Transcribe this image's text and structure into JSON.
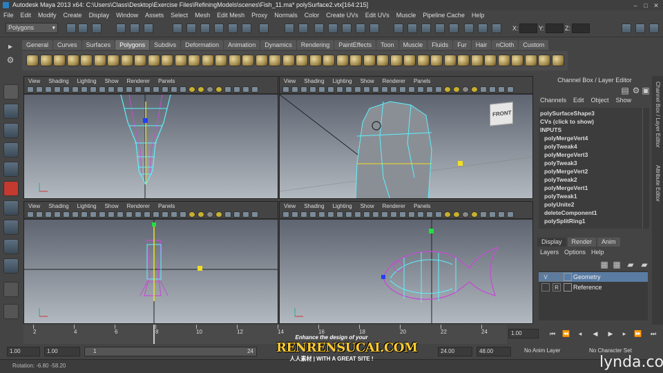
{
  "title": "Autodesk Maya 2013 x64: C:\\Users\\Class\\Desktop\\Exercise Files\\RefiningModels\\scenes\\Fish_11.ma*     polySurface2.vtx[164:215]",
  "window_controls": [
    "–",
    "□",
    "✕"
  ],
  "menubar": [
    "File",
    "Edit",
    "Modify",
    "Create",
    "Display",
    "Window",
    "Assets",
    "Select",
    "Mesh",
    "Edit Mesh",
    "Proxy",
    "Normals",
    "Color",
    "Create UVs",
    "Edit UVs",
    "Muscle",
    "Pipeline Cache",
    "Help"
  ],
  "status": {
    "mode": "Polygons",
    "x_label": "X:",
    "y_label": "Y:",
    "z_label": "Z:"
  },
  "shelf_tabs": [
    "General",
    "Curves",
    "Surfaces",
    "Polygons",
    "Subdivs",
    "Deformation",
    "Animation",
    "Dynamics",
    "Rendering",
    "PaintEffects",
    "Toon",
    "Muscle",
    "Fluids",
    "Fur",
    "Hair",
    "nCloth",
    "Custom"
  ],
  "shelf_active": "Polygons",
  "viewport_menu": [
    "View",
    "Shading",
    "Lighting",
    "Show",
    "Renderer",
    "Panels"
  ],
  "viewcube_label": "FRONT",
  "channel_box": {
    "title": "Channel Box / Layer Editor",
    "menu": [
      "Channels",
      "Edit",
      "Object",
      "Show"
    ],
    "shape": "polySurfaceShape3",
    "cvs": "CVs (click to show)",
    "inputs_header": "INPUTS",
    "inputs": [
      "polyMergeVert4",
      "polyTweak4",
      "polyMergeVert3",
      "polyTweak3",
      "polyMergeVert2",
      "polyTweak2",
      "polyMergeVert1",
      "polyTweak1",
      "polyUnite2",
      "deleteComponent1",
      "polySplitRing1"
    ]
  },
  "layer_editor": {
    "tabs": [
      "Display",
      "Render",
      "Anim"
    ],
    "menu": [
      "Layers",
      "Options",
      "Help"
    ],
    "layers": [
      {
        "flag1": "V",
        "flag2": "",
        "name": "Geometry"
      },
      {
        "flag1": "",
        "flag2": "R",
        "name": "Reference"
      }
    ]
  },
  "side_tabs": [
    "Channel Box / Layer Editor",
    "Attribute Editor"
  ],
  "time_slider": {
    "ticks": [
      "2",
      "4",
      "6",
      "8",
      "10",
      "12",
      "14",
      "16",
      "18",
      "20",
      "22",
      "24"
    ],
    "current_time": "1.00"
  },
  "range": {
    "start": "1.00",
    "inner_start": "1.00",
    "slider_start": "1",
    "slider_end": "24",
    "end": "24.00",
    "anim_end": "48.00",
    "anim_layer": "No Anim Layer",
    "char_set": "No Character Set"
  },
  "help_line": "Rotation:   -6.80    -58.20",
  "watermark": {
    "line1": "Enhance the design of your",
    "brand": "RENRENSUCAI.COM",
    "line3": "人人素材 | WITH A GREAT SITE !"
  },
  "logo": "lynda.com"
}
